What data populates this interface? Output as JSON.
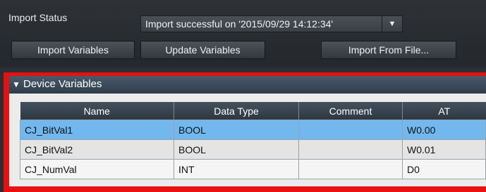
{
  "import_status": {
    "label": "Import Status",
    "value": "Import successful on '2015/09/29 14:12:34'"
  },
  "buttons": {
    "import_variables": "Import Variables",
    "update_variables": "Update Variables",
    "import_from_file": "Import From File..."
  },
  "panel": {
    "title": "Device Variables",
    "columns": [
      "Name",
      "Data Type",
      "Comment",
      "AT"
    ],
    "rows": [
      {
        "name": "CJ_BitVal1",
        "data_type": "BOOL",
        "comment": "",
        "at": "W0.00",
        "selected": true
      },
      {
        "name": "CJ_BitVal2",
        "data_type": "BOOL",
        "comment": "",
        "at": "W0.01",
        "selected": false
      },
      {
        "name": "CJ_NumVal",
        "data_type": "INT",
        "comment": "",
        "at": "D0",
        "selected": false
      }
    ]
  },
  "colors": {
    "highlight": "#e81010",
    "selected_row": "#72b8ee"
  },
  "icons": {
    "dropdown": "chevron-down-icon",
    "collapse": "triangle-down-icon"
  }
}
